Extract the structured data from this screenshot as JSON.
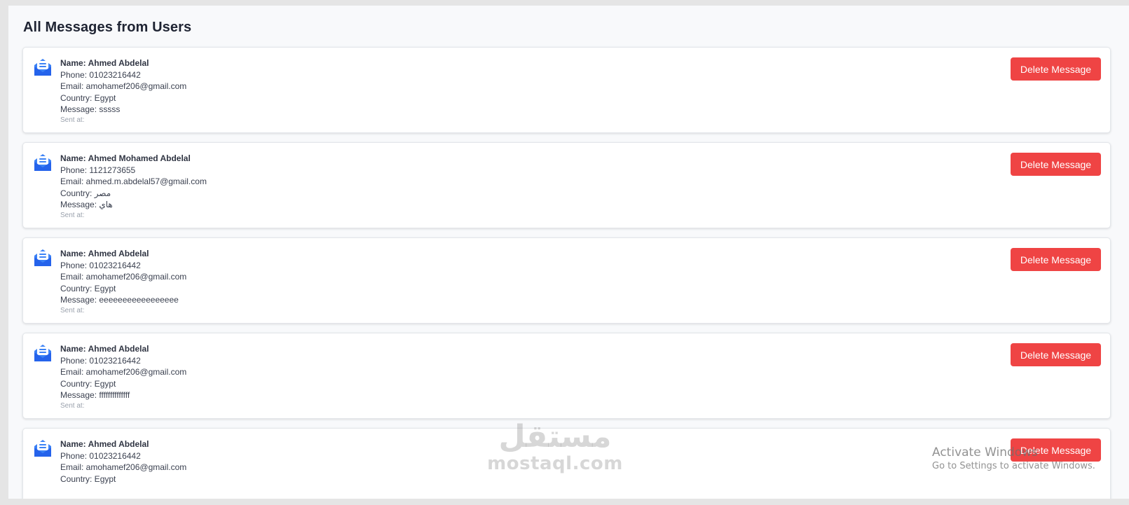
{
  "page": {
    "title": "All Messages from Users"
  },
  "messages": [
    {
      "name": "Name: Ahmed Abdelal",
      "phone": "Phone: 01023216442",
      "email": "Email: amohamef206@gmail.com",
      "country": "Country: Egypt",
      "message": "Message: sssss",
      "sent_at": "Sent at:",
      "delete_label": "Delete Message"
    },
    {
      "name": "Name: Ahmed Mohamed Abdelal",
      "phone": "Phone: 1121273655",
      "email": "Email: ahmed.m.abdelal57@gmail.com",
      "country": "Country: مصر",
      "message": "Message: هاي",
      "sent_at": "Sent at:",
      "delete_label": "Delete Message"
    },
    {
      "name": "Name: Ahmed Abdelal",
      "phone": "Phone: 01023216442",
      "email": "Email: amohamef206@gmail.com",
      "country": "Country: Egypt",
      "message": "Message: eeeeeeeeeeeeeeeee",
      "sent_at": "Sent at:",
      "delete_label": "Delete Message"
    },
    {
      "name": "Name: Ahmed Abdelal",
      "phone": "Phone: 01023216442",
      "email": "Email: amohamef206@gmail.com",
      "country": "Country: Egypt",
      "message": "Message: ffffffffffffff",
      "sent_at": "Sent at:",
      "delete_label": "Delete Message"
    },
    {
      "name": "Name: Ahmed Abdelal",
      "phone": "Phone: 01023216442",
      "email": "Email: amohamef206@gmail.com",
      "country": "Country: Egypt",
      "message": "",
      "sent_at": "",
      "delete_label": "Delete Message"
    }
  ],
  "watermark": {
    "arabic": "مستقل",
    "english": "mostaql.com"
  },
  "activation": {
    "line1": "Activate Windows",
    "line2": "Go to Settings to activate Windows."
  },
  "icons": {
    "message": "envelope-message-icon"
  },
  "colors": {
    "accent_blue": "#3b82f6",
    "delete_red": "#ef4444",
    "page_bg": "#f8f9fb",
    "text_dark": "#1f2433"
  }
}
